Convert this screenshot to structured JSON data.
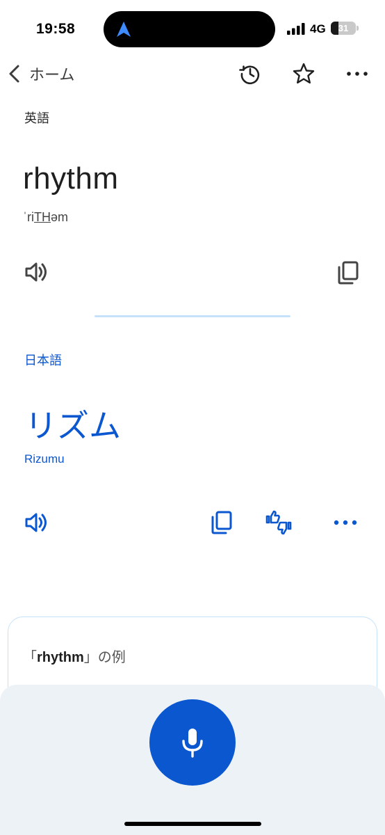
{
  "status_bar": {
    "time": "19:58",
    "network": "4G",
    "battery": "31",
    "battery_level": 0.31
  },
  "header": {
    "back_label": "ホーム",
    "icons": [
      "history-icon",
      "star-icon",
      "more-icon"
    ]
  },
  "source": {
    "language": "英語",
    "word": "rhythm",
    "phonetic_prefix": "ˈri",
    "phonetic_underlined": "TH",
    "phonetic_suffix": "əm"
  },
  "target": {
    "language": "日本語",
    "word": "リズム",
    "romanization": "Rizumu"
  },
  "examples": {
    "open_bracket": "「",
    "word": "rhythm",
    "close_suffix": "」の例"
  },
  "colors": {
    "accent": "#0b57d0",
    "divider": "#c6e2fb",
    "sheet": "#edf2f7"
  }
}
